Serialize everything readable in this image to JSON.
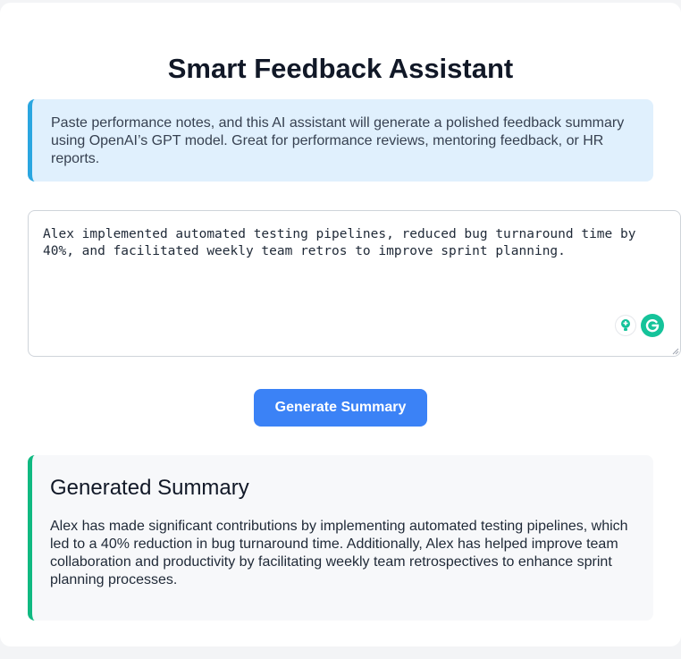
{
  "app": {
    "title": "Smart Feedback Assistant",
    "intro": "Paste performance notes, and this AI assistant will generate a polished feedback summary using OpenAI’s GPT model. Great for performance reviews, mentoring feedback, or HR reports."
  },
  "input": {
    "notes_value": "Alex implemented automated testing pipelines, reduced bug turnaround time by 40%, and facilitated weekly team retros to improve sprint planning.",
    "grammarly_icons": [
      "lightbulb-icon",
      "grammarly-logo-icon"
    ]
  },
  "actions": {
    "generate_label": "Generate Summary"
  },
  "summary": {
    "heading": "Generated Summary",
    "text": "Alex has made significant contributions by implementing automated testing pipelines, which led to a 40% reduction in bug turnaround time. Additionally, Alex has helped improve team collaboration and productivity by facilitating weekly team retrospectives to enhance sprint planning processes."
  },
  "colors": {
    "accent_blue": "#3b82f6",
    "intro_border": "#2aa6e0",
    "intro_bg": "#e0f0fd",
    "summary_border": "#10b981",
    "summary_bg": "#f7f8fa",
    "grammarly_green": "#15c39a"
  }
}
